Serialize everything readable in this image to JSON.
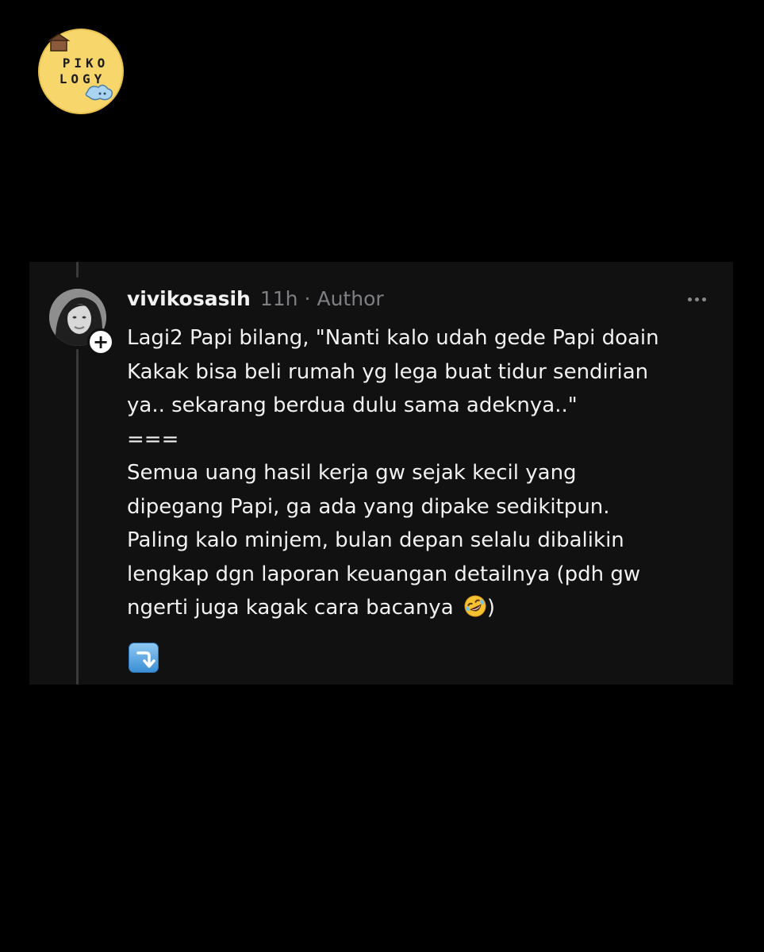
{
  "logo": {
    "line1": "PIKO",
    "line2": "LOGY",
    "icon": "piko-logy-logo-icon",
    "background": "#f7d66b"
  },
  "post": {
    "username": "vivikosasih",
    "timestamp": "11h",
    "separator": "·",
    "role": "Author",
    "avatar_icon": "profile-photo-avatar",
    "follow_icon": "plus-icon",
    "follow_label": "+",
    "more_icon": "more-options-icon",
    "lines": [
      "Lagi2 Papi bilang, \"Nanti kalo udah gede Papi doain",
      "Kakak bisa beli rumah yg lega buat tidur sendirian",
      "ya.. sekarang berdua dulu sama adeknya..\"",
      "===",
      "Semua uang hasil kerja gw sejak kecil yang",
      "dipegang Papi, ga ada yang dipake sedikitpun.",
      "Paling kalo minjem, bulan depan selalu dibalikin",
      "lengkap dgn laporan keuangan detailnya (pdh gw",
      "ngerti juga kagak cara bacanya"
    ],
    "last_line_suffix": ")",
    "laugh_emoji_icon": "rolling-on-floor-laughing-emoji-icon",
    "continue_icon": "arrow-down-key-icon"
  },
  "colors": {
    "page_background": "#000000",
    "card_background": "#111112",
    "primary_text": "#f1f1f1",
    "secondary_text": "#7f7f83"
  }
}
